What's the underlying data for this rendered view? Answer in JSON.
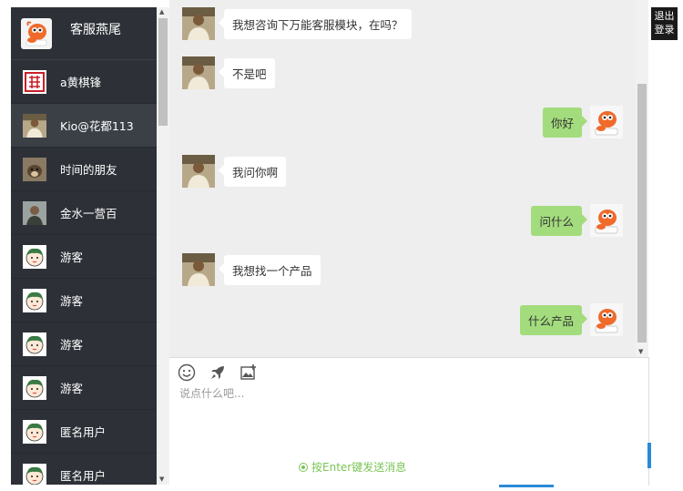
{
  "current_user": {
    "name": "客服燕尾",
    "avatar": "orange-mascot"
  },
  "contacts": [
    {
      "name": "a黄棋锋",
      "avatar": "red-seal",
      "active": false
    },
    {
      "name": "Kio@花都113",
      "avatar": "man-photo",
      "active": true
    },
    {
      "name": "时间的朋友",
      "avatar": "dog-photo",
      "active": false
    },
    {
      "name": "金水一营百",
      "avatar": "person-photo",
      "active": false
    },
    {
      "name": "游客",
      "avatar": "cartoon-kid",
      "active": false
    },
    {
      "name": "游客",
      "avatar": "cartoon-kid",
      "active": false
    },
    {
      "name": "游客",
      "avatar": "cartoon-kid",
      "active": false
    },
    {
      "name": "游客",
      "avatar": "cartoon-kid",
      "active": false
    },
    {
      "name": "匿名用户",
      "avatar": "cartoon-kid",
      "active": false
    },
    {
      "name": "匿名用户",
      "avatar": "cartoon-kid",
      "active": false
    }
  ],
  "messages": [
    {
      "side": "left",
      "text": "我想咨询下万能客服模块，在吗？"
    },
    {
      "side": "left",
      "text": "不是吧"
    },
    {
      "side": "right",
      "text": "你好"
    },
    {
      "side": "left",
      "text": "我问你啊"
    },
    {
      "side": "right",
      "text": "问什么"
    },
    {
      "side": "left",
      "text": "我想找一个产品"
    },
    {
      "side": "right",
      "text": "什么产品"
    }
  ],
  "toolbar": {
    "tools": [
      "smiley-icon",
      "rocket-icon",
      "image-add-icon"
    ]
  },
  "input": {
    "placeholder": "说点什么吧..."
  },
  "send_hint": "按Enter键发送消息",
  "logout": {
    "line1": "退出",
    "line2": "登录"
  },
  "colors": {
    "sidebar_bg": "#2d3137",
    "chat_bg": "#eeeeee",
    "bubble_self": "#a3dc7d",
    "accent_green": "#7ac555"
  }
}
